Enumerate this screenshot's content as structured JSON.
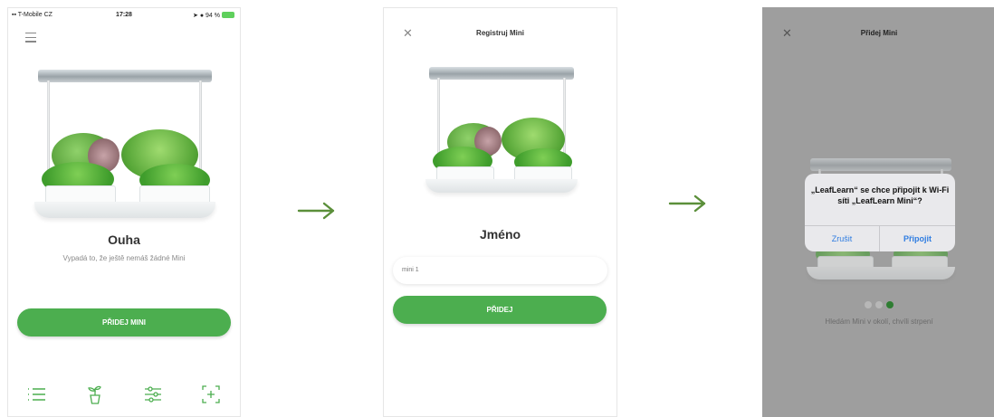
{
  "screen1": {
    "status": {
      "carrier": "T-Mobile CZ",
      "time": "17:28",
      "battery": "94 %"
    },
    "title": "Ouha",
    "subtitle": "Vypadá to, že ještě nemáš žádné Mini",
    "button_label": "PŘIDEJ MINI",
    "tabs": [
      "list-icon",
      "plant-icon",
      "settings-sliders-icon",
      "scan-add-icon"
    ]
  },
  "screen2": {
    "header_title": "Registruj Mini",
    "title": "Jméno",
    "input_value": "mini 1",
    "button_label": "PŘIDEJ"
  },
  "screen3": {
    "header_title": "Přidej Mini",
    "alert_message": "„LeafLearn“ se chce připojit k Wi-Fi síti „LeafLearn Mini“?",
    "cancel_label": "Zrušit",
    "confirm_label": "Připojit",
    "status_text": "Hledám Mini v okolí, chvíli strpení",
    "progress_dots": {
      "total": 3,
      "active": 3
    }
  },
  "colors": {
    "accent_green": "#4cae4f",
    "arrow_green": "#5b8f3a",
    "ios_blue": "#2f7de1",
    "overlay_grey": "#9e9e9e"
  }
}
